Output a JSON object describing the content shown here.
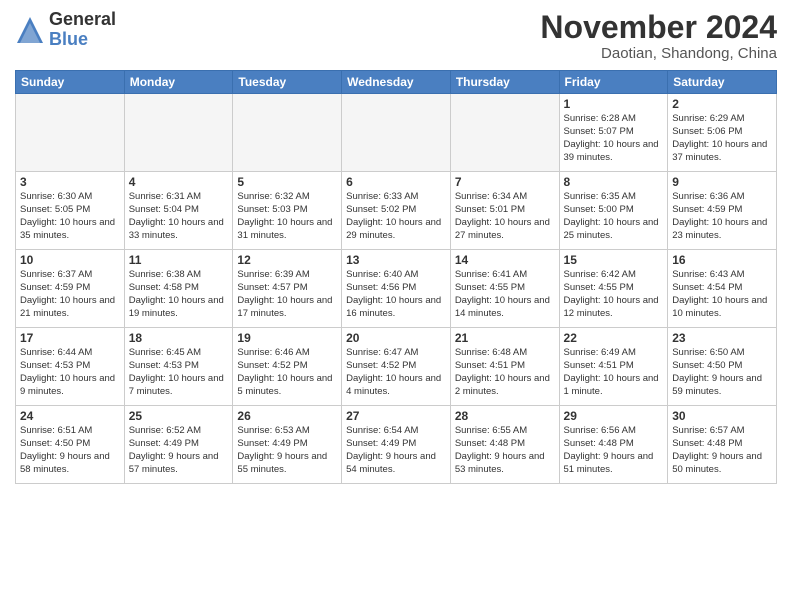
{
  "logo": {
    "general": "General",
    "blue": "Blue"
  },
  "header": {
    "title": "November 2024",
    "subtitle": "Daotian, Shandong, China"
  },
  "columns": [
    "Sunday",
    "Monday",
    "Tuesday",
    "Wednesday",
    "Thursday",
    "Friday",
    "Saturday"
  ],
  "weeks": [
    [
      {
        "day": "",
        "info": ""
      },
      {
        "day": "",
        "info": ""
      },
      {
        "day": "",
        "info": ""
      },
      {
        "day": "",
        "info": ""
      },
      {
        "day": "",
        "info": ""
      },
      {
        "day": "1",
        "info": "Sunrise: 6:28 AM\nSunset: 5:07 PM\nDaylight: 10 hours\nand 39 minutes."
      },
      {
        "day": "2",
        "info": "Sunrise: 6:29 AM\nSunset: 5:06 PM\nDaylight: 10 hours\nand 37 minutes."
      }
    ],
    [
      {
        "day": "3",
        "info": "Sunrise: 6:30 AM\nSunset: 5:05 PM\nDaylight: 10 hours\nand 35 minutes."
      },
      {
        "day": "4",
        "info": "Sunrise: 6:31 AM\nSunset: 5:04 PM\nDaylight: 10 hours\nand 33 minutes."
      },
      {
        "day": "5",
        "info": "Sunrise: 6:32 AM\nSunset: 5:03 PM\nDaylight: 10 hours\nand 31 minutes."
      },
      {
        "day": "6",
        "info": "Sunrise: 6:33 AM\nSunset: 5:02 PM\nDaylight: 10 hours\nand 29 minutes."
      },
      {
        "day": "7",
        "info": "Sunrise: 6:34 AM\nSunset: 5:01 PM\nDaylight: 10 hours\nand 27 minutes."
      },
      {
        "day": "8",
        "info": "Sunrise: 6:35 AM\nSunset: 5:00 PM\nDaylight: 10 hours\nand 25 minutes."
      },
      {
        "day": "9",
        "info": "Sunrise: 6:36 AM\nSunset: 4:59 PM\nDaylight: 10 hours\nand 23 minutes."
      }
    ],
    [
      {
        "day": "10",
        "info": "Sunrise: 6:37 AM\nSunset: 4:59 PM\nDaylight: 10 hours\nand 21 minutes."
      },
      {
        "day": "11",
        "info": "Sunrise: 6:38 AM\nSunset: 4:58 PM\nDaylight: 10 hours\nand 19 minutes."
      },
      {
        "day": "12",
        "info": "Sunrise: 6:39 AM\nSunset: 4:57 PM\nDaylight: 10 hours\nand 17 minutes."
      },
      {
        "day": "13",
        "info": "Sunrise: 6:40 AM\nSunset: 4:56 PM\nDaylight: 10 hours\nand 16 minutes."
      },
      {
        "day": "14",
        "info": "Sunrise: 6:41 AM\nSunset: 4:55 PM\nDaylight: 10 hours\nand 14 minutes."
      },
      {
        "day": "15",
        "info": "Sunrise: 6:42 AM\nSunset: 4:55 PM\nDaylight: 10 hours\nand 12 minutes."
      },
      {
        "day": "16",
        "info": "Sunrise: 6:43 AM\nSunset: 4:54 PM\nDaylight: 10 hours\nand 10 minutes."
      }
    ],
    [
      {
        "day": "17",
        "info": "Sunrise: 6:44 AM\nSunset: 4:53 PM\nDaylight: 10 hours\nand 9 minutes."
      },
      {
        "day": "18",
        "info": "Sunrise: 6:45 AM\nSunset: 4:53 PM\nDaylight: 10 hours\nand 7 minutes."
      },
      {
        "day": "19",
        "info": "Sunrise: 6:46 AM\nSunset: 4:52 PM\nDaylight: 10 hours\nand 5 minutes."
      },
      {
        "day": "20",
        "info": "Sunrise: 6:47 AM\nSunset: 4:52 PM\nDaylight: 10 hours\nand 4 minutes."
      },
      {
        "day": "21",
        "info": "Sunrise: 6:48 AM\nSunset: 4:51 PM\nDaylight: 10 hours\nand 2 minutes."
      },
      {
        "day": "22",
        "info": "Sunrise: 6:49 AM\nSunset: 4:51 PM\nDaylight: 10 hours\nand 1 minute."
      },
      {
        "day": "23",
        "info": "Sunrise: 6:50 AM\nSunset: 4:50 PM\nDaylight: 9 hours\nand 59 minutes."
      }
    ],
    [
      {
        "day": "24",
        "info": "Sunrise: 6:51 AM\nSunset: 4:50 PM\nDaylight: 9 hours\nand 58 minutes."
      },
      {
        "day": "25",
        "info": "Sunrise: 6:52 AM\nSunset: 4:49 PM\nDaylight: 9 hours\nand 57 minutes."
      },
      {
        "day": "26",
        "info": "Sunrise: 6:53 AM\nSunset: 4:49 PM\nDaylight: 9 hours\nand 55 minutes."
      },
      {
        "day": "27",
        "info": "Sunrise: 6:54 AM\nSunset: 4:49 PM\nDaylight: 9 hours\nand 54 minutes."
      },
      {
        "day": "28",
        "info": "Sunrise: 6:55 AM\nSunset: 4:48 PM\nDaylight: 9 hours\nand 53 minutes."
      },
      {
        "day": "29",
        "info": "Sunrise: 6:56 AM\nSunset: 4:48 PM\nDaylight: 9 hours\nand 51 minutes."
      },
      {
        "day": "30",
        "info": "Sunrise: 6:57 AM\nSunset: 4:48 PM\nDaylight: 9 hours\nand 50 minutes."
      }
    ]
  ]
}
